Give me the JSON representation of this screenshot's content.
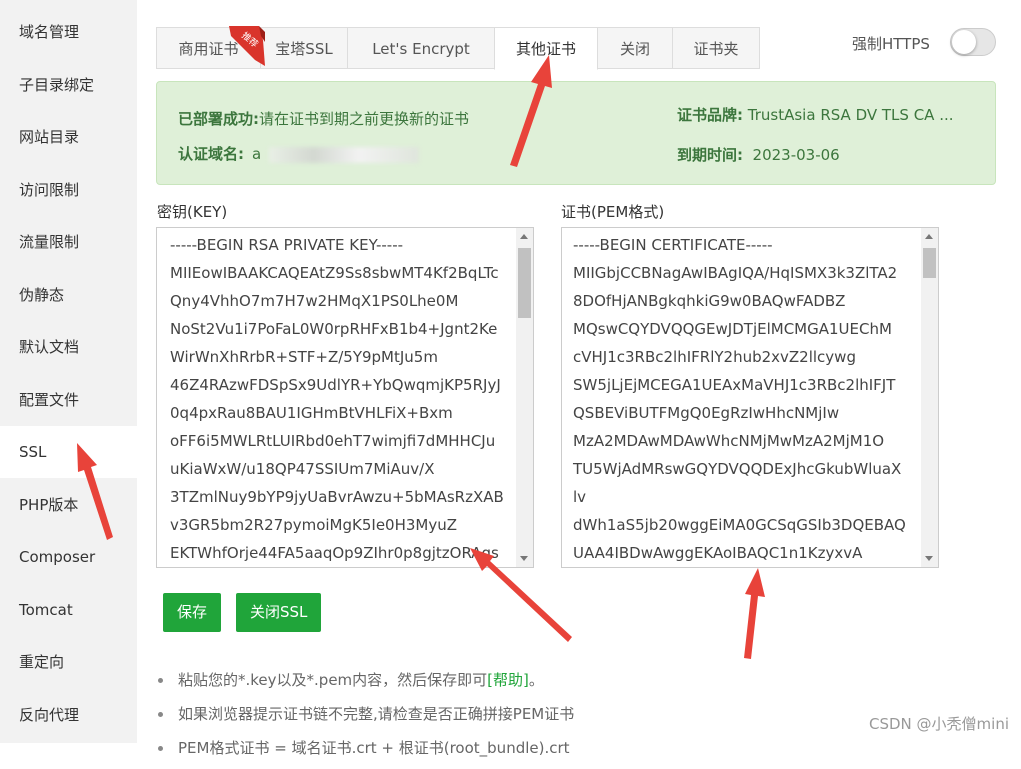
{
  "sidebar": {
    "items": [
      {
        "label": "域名管理"
      },
      {
        "label": "子目录绑定"
      },
      {
        "label": "网站目录"
      },
      {
        "label": "访问限制"
      },
      {
        "label": "流量限制"
      },
      {
        "label": "伪静态"
      },
      {
        "label": "默认文档"
      },
      {
        "label": "配置文件"
      },
      {
        "label": "SSL",
        "active": true
      },
      {
        "label": "PHP版本"
      },
      {
        "label": "Composer"
      },
      {
        "label": "Tomcat"
      },
      {
        "label": "重定向"
      },
      {
        "label": "反向代理"
      }
    ]
  },
  "tabs": [
    {
      "label": "商用证书",
      "badge": "推荐"
    },
    {
      "label": "宝塔SSL"
    },
    {
      "label": "Let's Encrypt"
    },
    {
      "label": "其他证书",
      "active": true
    },
    {
      "label": "关闭"
    },
    {
      "label": "证书夹"
    }
  ],
  "force_https": {
    "label": "强制HTTPS",
    "enabled": false
  },
  "status": {
    "deployed_label": "已部署成功:",
    "deployed_message": "请在证书到期之前更换新的证书",
    "domain_label": "认证域名:",
    "domain_value": "a",
    "brand_label": "证书品牌:",
    "brand_value": "TrustAsia RSA DV TLS CA ...",
    "expiry_label": "到期时间:",
    "expiry_value": "2023-03-06"
  },
  "key_field": {
    "label": "密钥(KEY)",
    "value": "-----BEGIN RSA PRIVATE KEY-----\nMIIEowIBAAKCAQEAtZ9Ss8sbwMT4Kf2BqLTc\nQny4VhhO7m7H7w2HMqX1PS0Lhe0M\nNoSt2Vu1i7PoFaL0W0rpRHFxB1b4+Jgnt2Ke\nWirWnXhRrbR+STF+Z/5Y9pMtJu5m\n46Z4RAzwFDSpSx9UdlYR+YbQwqmjKP5RJyJ\n0q4pxRau8BAU1IGHmBtVHLFiX+Bxm\noFF6i5MWLRtLUIRbd0ehT7wimjfi7dMHHCJu\nuKiaWxW/u18QP47SSIUm7MiAuv/X\n3TZmlNuy9bYP9jyUaBvrAwzu+5bMAsRzXAB\nv3GR5bm2R27pymoiMgK5Ie0H3MyuZ\nEKTWhfOrje44FA5aaqOp9ZIhr0p8gjtzORAgs"
  },
  "cert_field": {
    "label": "证书(PEM格式)",
    "value": "-----BEGIN CERTIFICATE-----\nMIIGbjCCBNagAwIBAgIQA/HqISMX3k3ZlTA2\n8DOfHjANBgkqhkiG9w0BAQwFADBZ\nMQswCQYDVQQGEwJDTjElMCMGA1UEChM\ncVHJ1c3RBc2lhIFRlY2hub2xvZ2llcywg\nSW5jLjEjMCEGA1UEAxMaVHJ1c3RBc2lhIFJT\nQSBEViBUTFMgQ0EgRzIwHhcNMjIw\nMzA2MDAwMDAwWhcNMjMwMzA2MjM1O\nTU5WjAdMRswGQYDVQQDExJhcGkubWluaX\nlv\ndWh1aS5jb20wggEiMA0GCSqGSIb3DQEBAQ\nUAA4IBDwAwggEKAoIBAQC1n1KzyxvA"
  },
  "buttons": {
    "save": "保存",
    "close_ssl": "关闭SSL"
  },
  "tips": [
    {
      "text": "粘贴您的*.key以及*.pem内容，然后保存即可",
      "help": "[帮助]",
      "suffix": "。"
    },
    {
      "text": "如果浏览器提示证书链不完整,请检查是否正确拼接PEM证书"
    },
    {
      "text": "PEM格式证书 = 域名证书.crt + 根证书(root_bundle).crt"
    }
  ],
  "watermark": "CSDN @小秃僧mini",
  "colors": {
    "accent": "#20a53a",
    "success_bg": "#dff0d8",
    "success_text": "#3c763d",
    "arrow": "#e8433a"
  }
}
